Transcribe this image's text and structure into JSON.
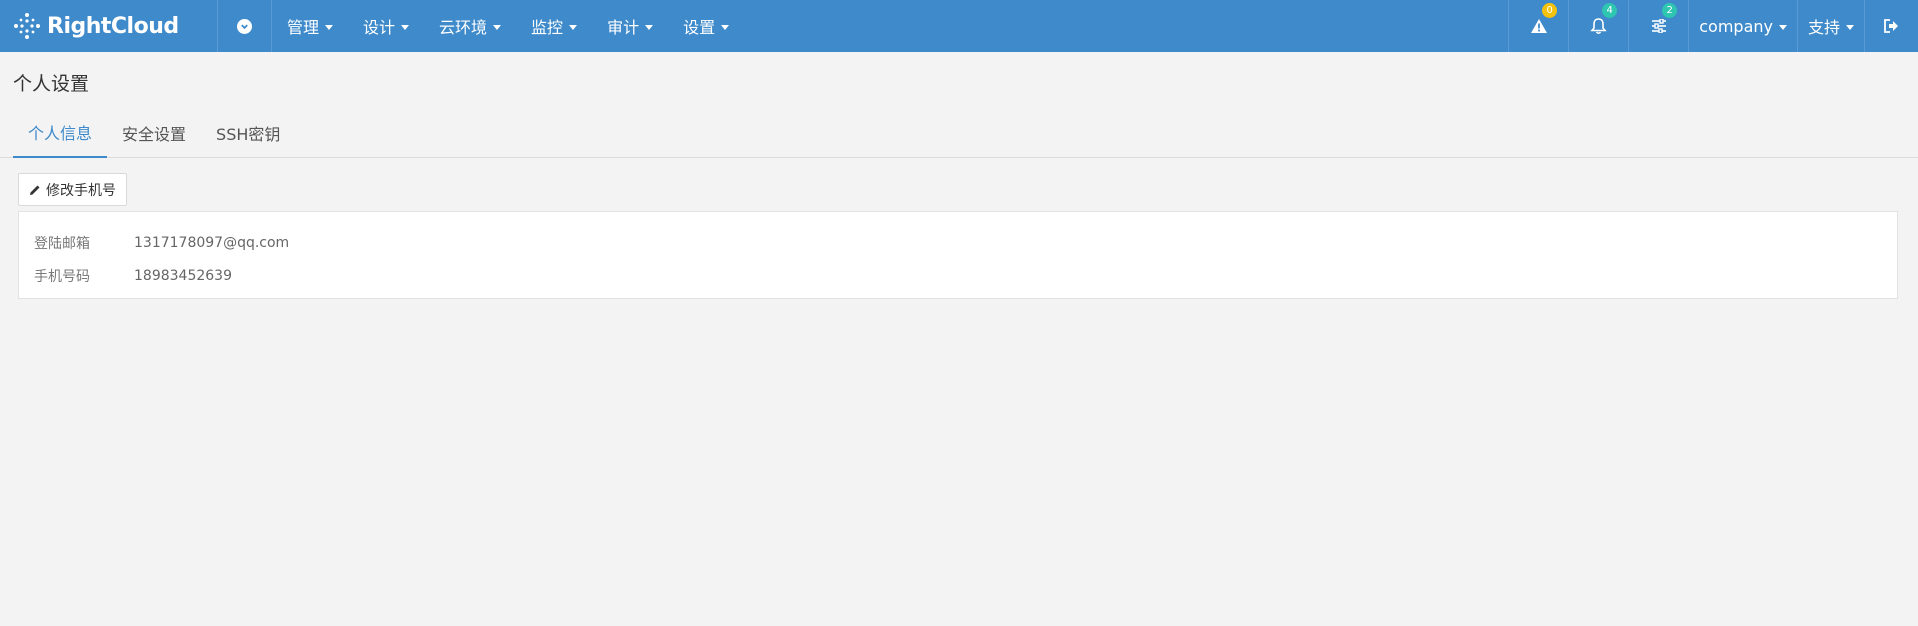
{
  "brand": {
    "name": "RightCloud"
  },
  "nav": {
    "items": [
      {
        "label": "管理"
      },
      {
        "label": "设计"
      },
      {
        "label": "云环境"
      },
      {
        "label": "监控"
      },
      {
        "label": "审计"
      },
      {
        "label": "设置"
      }
    ],
    "alerts_count": "0",
    "notifications_count": "4",
    "tasks_count": "2",
    "company_label": "company",
    "support_label": "支持"
  },
  "page": {
    "title": "个人设置"
  },
  "tabs": [
    {
      "label": "个人信息",
      "active": true
    },
    {
      "label": "安全设置",
      "active": false
    },
    {
      "label": "SSH密钥",
      "active": false
    }
  ],
  "toolbar": {
    "edit_phone_label": "修改手机号"
  },
  "profile": {
    "email_label": "登陆邮箱",
    "email_value": "1317178097@qq.com",
    "phone_label": "手机号码",
    "phone_value": "18983452639"
  },
  "colors": {
    "nav_bg": "#3e8acb",
    "badge_yellow": "#f4c20d",
    "badge_teal": "#2ec6b0",
    "tab_active": "#3e8acb"
  }
}
